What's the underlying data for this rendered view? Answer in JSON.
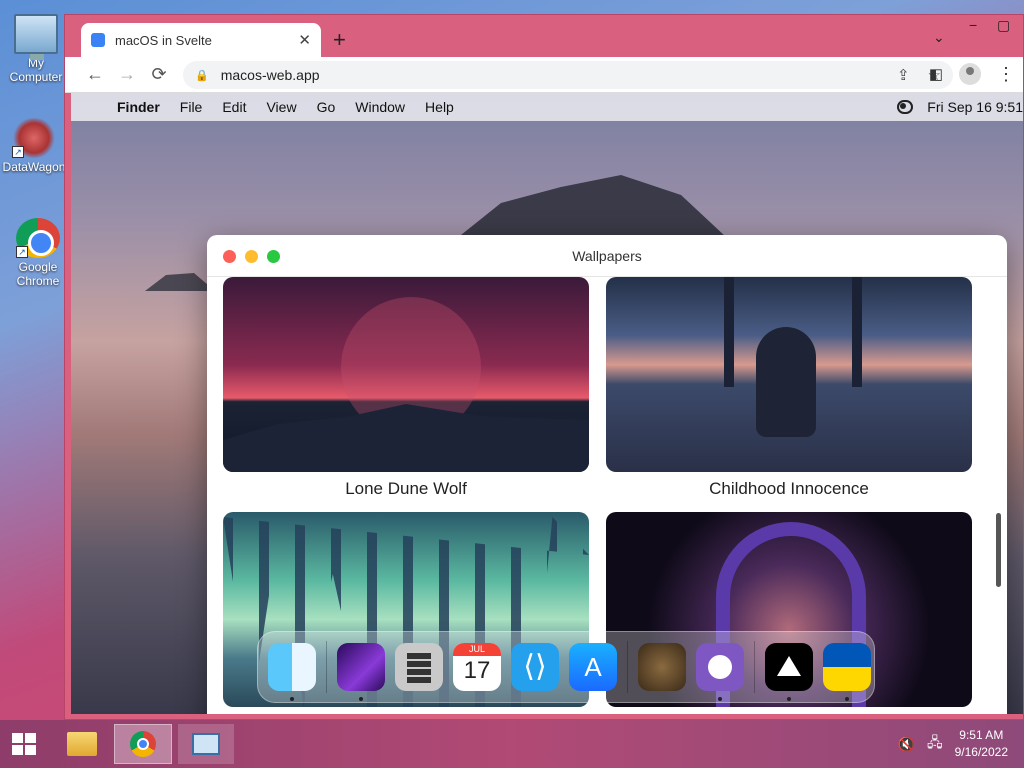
{
  "desktop": {
    "icons": [
      {
        "label": "My Computer"
      },
      {
        "label": "DataWagon"
      },
      {
        "label": "Google Chrome"
      }
    ]
  },
  "browser": {
    "tab_title": "macOS in Svelte",
    "tab_close": "✕",
    "new_tab": "+",
    "url": "macos-web.app",
    "back": "←",
    "forward": "→",
    "reload": "⟳",
    "minimize": "−",
    "maximize": "▢",
    "tab_search": "⌄"
  },
  "mac": {
    "menubar": {
      "app": "Finder",
      "menus": [
        "File",
        "Edit",
        "View",
        "Go",
        "Window",
        "Help"
      ],
      "datetime": "Fri Sep 16  9:51"
    },
    "window": {
      "title": "Wallpapers",
      "wallpapers": [
        {
          "label": "Lone Dune Wolf"
        },
        {
          "label": "Childhood Innocence"
        }
      ]
    },
    "dock": {
      "calendar_month": "JUL",
      "calendar_day": "17"
    }
  },
  "taskbar": {
    "time": "9:51 AM",
    "date": "9/16/2022"
  }
}
